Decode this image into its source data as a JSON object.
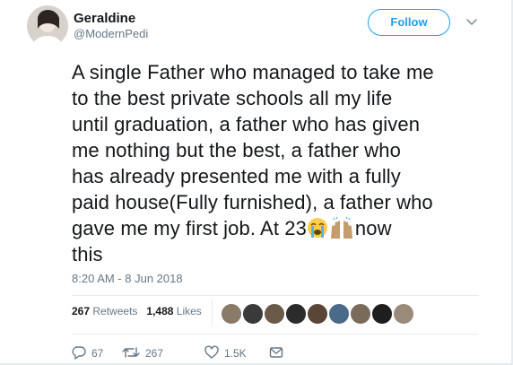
{
  "tweet": {
    "author_name": "Geraldine",
    "author_handle": "@ModernPedi",
    "follow_label": "Follow",
    "text_lines": [
      "A single Father who managed to take me",
      "to the best private schools all my life",
      "until graduation, a father who has given",
      "me nothing but the best, a father who",
      "has already presented me with a fully",
      "paid house(Fully furnished), a father who",
      "gave me my first job. At 23",
      "now",
      "this"
    ],
    "timestamp": "8:20 AM - 8 Jun 2018",
    "retweets_count": "267",
    "retweets_label": "Retweets",
    "likes_count": "1,488",
    "likes_label": "Likes",
    "actions": {
      "reply_count": "67",
      "retweet_count": "267",
      "like_count": "1.5K"
    }
  },
  "icons": {
    "reply": "reply-icon",
    "retweet": "retweet-icon",
    "like": "heart-icon",
    "message": "envelope-icon",
    "caret": "chevron-down-icon",
    "emoji_1": "loudly-crying-face-emoji",
    "emoji_2": "raising-hands-emoji"
  },
  "colors": {
    "accent": "#1da1f2",
    "secondary_text": "#657786",
    "primary_text": "#14171a",
    "divider": "#e6ecf0"
  }
}
